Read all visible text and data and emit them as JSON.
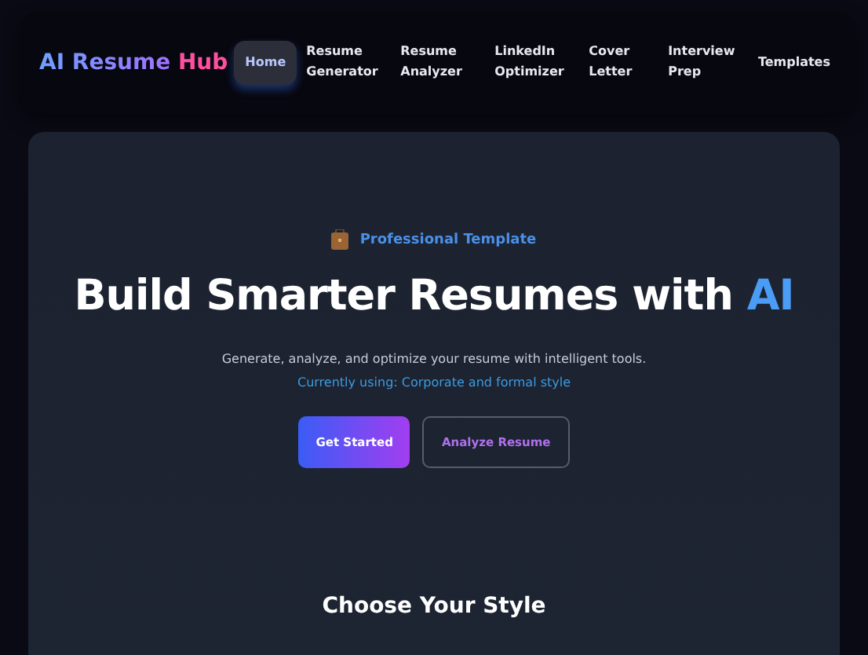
{
  "logo": {
    "text": "AI Resume",
    "accent": "Hub"
  },
  "nav": [
    {
      "label": "Home",
      "selected": true
    },
    {
      "label": "Resume Generator",
      "selected": false
    },
    {
      "label": "Resume Analyzer",
      "selected": false
    },
    {
      "label": "LinkedIn Optimizer",
      "selected": false
    },
    {
      "label": "Cover Letter",
      "selected": false
    },
    {
      "label": "Interview Prep",
      "selected": false
    },
    {
      "label": "Templates",
      "selected": false
    }
  ],
  "hero": {
    "badge": "Professional Template",
    "title": "Build Smarter Resumes with",
    "title_highlight": "AI",
    "subtitle": "Generate, analyze, and optimize your resume with intelligent tools.",
    "current": "Currently using: Corporate and formal style",
    "buttons": [
      {
        "label": "Get Started",
        "kind": "primary"
      },
      {
        "label": "Analyze Resume",
        "kind": "outline"
      }
    ]
  },
  "section_title": "Choose Your Style"
}
